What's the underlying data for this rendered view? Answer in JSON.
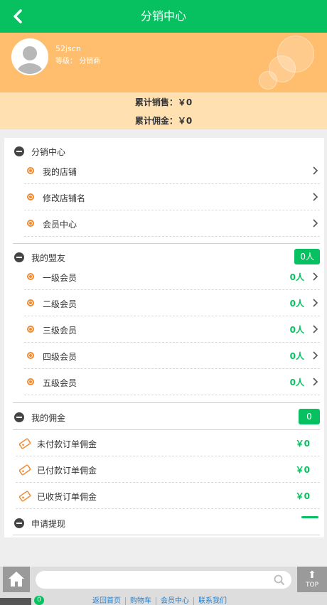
{
  "header": {
    "title": "分销中心"
  },
  "profile": {
    "username": "52jscn",
    "level": "等级：  分销商"
  },
  "stats": {
    "sales": "累计销售：￥0",
    "commission": "累计佣金：￥0"
  },
  "sections": {
    "center": {
      "title": "分销中心",
      "items": [
        {
          "label": "我的店铺"
        },
        {
          "label": "修改店铺名"
        },
        {
          "label": "会员中心"
        }
      ]
    },
    "allies": {
      "title": "我的盟友",
      "badge": "0人",
      "items": [
        {
          "label": "一级会员",
          "count": "0人"
        },
        {
          "label": "二级会员",
          "count": "0人"
        },
        {
          "label": "三级会员",
          "count": "0人"
        },
        {
          "label": "四级会员",
          "count": "0人"
        },
        {
          "label": "五级会员",
          "count": "0人"
        }
      ]
    },
    "commission": {
      "title": "我的佣金",
      "badge": "0",
      "items": [
        {
          "label": "未付款订单佣金",
          "amount": "￥0"
        },
        {
          "label": "已付款订单佣金",
          "amount": "￥0"
        },
        {
          "label": "已收货订单佣金",
          "amount": "￥0"
        }
      ]
    },
    "withdraw": {
      "title": "申请提现"
    }
  },
  "bottom": {
    "top_label": "TOP",
    "cart_count": "0",
    "links": [
      "返回首页",
      "购物车",
      "会员中心",
      "联系我们"
    ]
  },
  "colors": {
    "accent": "#07c160",
    "profile_bg": "#ffbd6e",
    "stats_bg": "#ffe0b0",
    "bullet": "#f08a30"
  }
}
